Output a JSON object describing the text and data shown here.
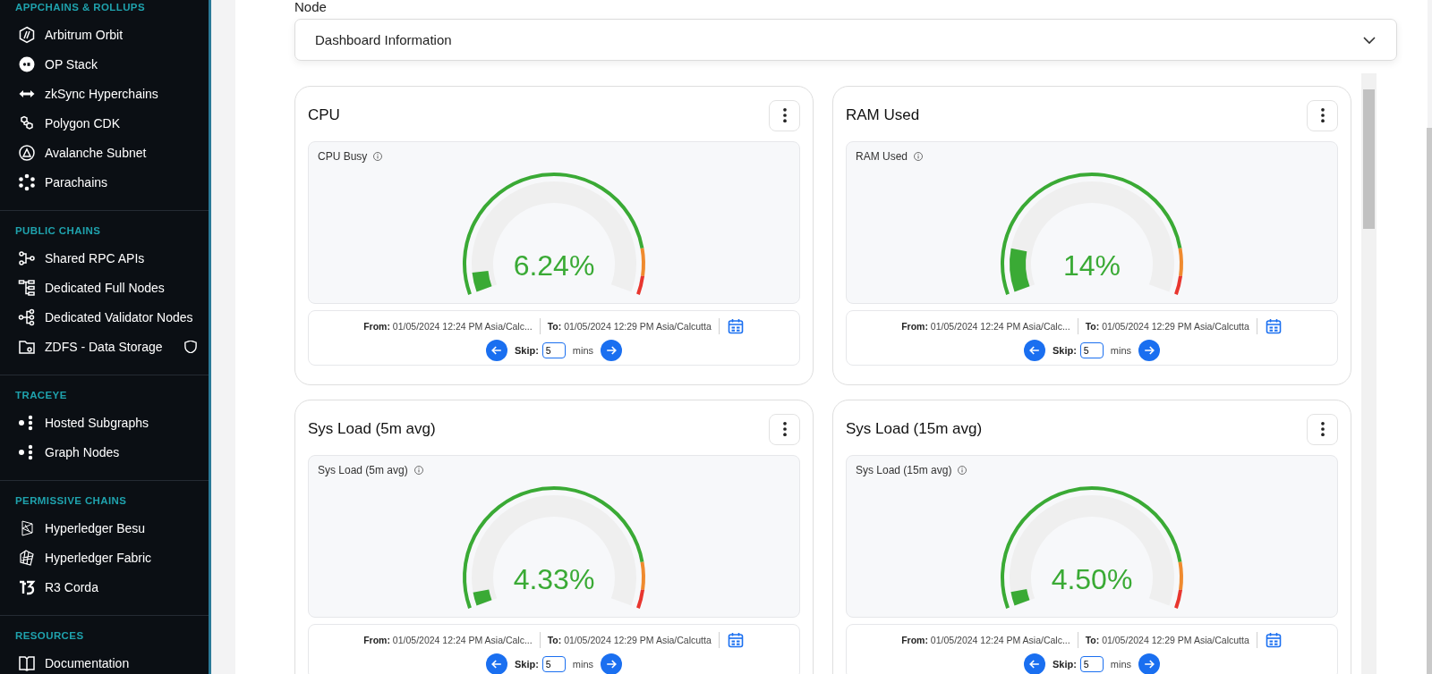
{
  "sidebar": {
    "sections": [
      {
        "heading": "APPCHAINS & ROLLUPS",
        "items": [
          {
            "label": "Arbitrum Orbit"
          },
          {
            "label": "OP Stack"
          },
          {
            "label": "zkSync Hyperchains"
          },
          {
            "label": "Polygon CDK"
          },
          {
            "label": "Avalanche Subnet"
          },
          {
            "label": "Parachains"
          }
        ]
      },
      {
        "heading": "PUBLIC CHAINS",
        "items": [
          {
            "label": "Shared RPC APIs"
          },
          {
            "label": "Dedicated Full Nodes"
          },
          {
            "label": "Dedicated Validator Nodes"
          },
          {
            "label": "ZDFS - Data Storage",
            "trailing_icon": true
          }
        ]
      },
      {
        "heading": "TRACEYE",
        "items": [
          {
            "label": "Hosted Subgraphs"
          },
          {
            "label": "Graph Nodes"
          }
        ]
      },
      {
        "heading": "PERMISSIVE CHAINS",
        "items": [
          {
            "label": "Hyperledger Besu"
          },
          {
            "label": "Hyperledger Fabric"
          },
          {
            "label": "R3 Corda"
          }
        ]
      },
      {
        "heading": "RESOURCES",
        "items": [
          {
            "label": "Documentation"
          }
        ]
      }
    ]
  },
  "section_label": "Node",
  "dropdown": {
    "value": "Dashboard Information",
    "expanded": false
  },
  "cards": [
    {
      "title": "CPU",
      "panel_title": "CPU Busy",
      "level": 0.0624,
      "reading": "6.24%",
      "from_label": "From:",
      "from": "01/05/2024 12:24 PM Asia/Calc...",
      "to_label": "To:",
      "to": "01/05/2024 12:29 PM Asia/Calcutta",
      "skip_label": "Skip:",
      "skip": "5",
      "unit": "mins"
    },
    {
      "title": "RAM Used",
      "panel_title": "RAM Used",
      "level": 0.14,
      "reading": "14%",
      "from_label": "From:",
      "from": "01/05/2024 12:24 PM Asia/Calc...",
      "to_label": "To:",
      "to": "01/05/2024 12:29 PM Asia/Calcutta",
      "skip_label": "Skip:",
      "skip": "5",
      "unit": "mins"
    },
    {
      "title": "Sys Load (5m avg)",
      "panel_title": "Sys Load (5m avg)",
      "level": 0.0433,
      "reading": "4.33%",
      "from_label": "From:",
      "from": "01/05/2024 12:24 PM Asia/Calc...",
      "to_label": "To:",
      "to": "01/05/2024 12:29 PM Asia/Calcutta",
      "skip_label": "Skip:",
      "skip": "5",
      "unit": "mins"
    },
    {
      "title": "Sys Load (15m avg)",
      "panel_title": "Sys Load (15m avg)",
      "level": 0.045,
      "reading": "4.50%",
      "from_label": "From:",
      "from": "01/05/2024 12:24 PM Asia/Calc...",
      "to_label": "To:",
      "to": "01/05/2024 12:29 PM Asia/Calcutta",
      "skip_label": "Skip:",
      "skip": "5",
      "unit": "mins"
    }
  ]
}
